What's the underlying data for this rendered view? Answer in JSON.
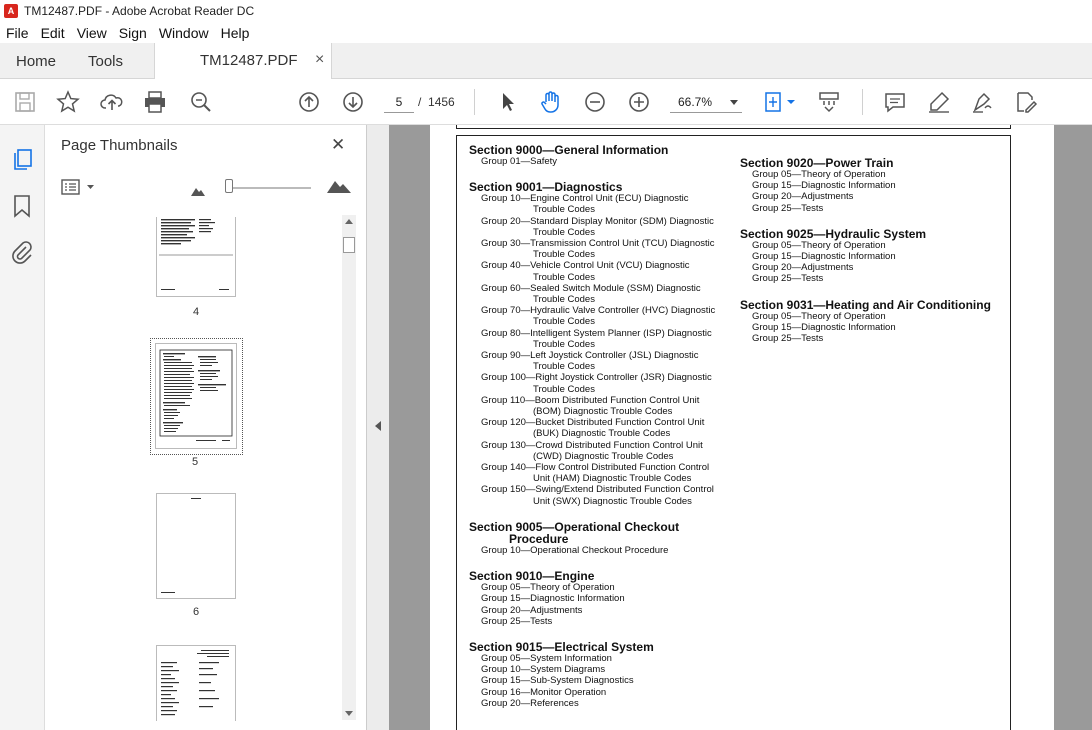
{
  "window": {
    "title": "TM12487.PDF - Adobe Acrobat Reader DC"
  },
  "menu": [
    "File",
    "Edit",
    "View",
    "Sign",
    "Window",
    "Help"
  ],
  "tabs": {
    "home": "Home",
    "tools": "Tools",
    "document": "TM12487.PDF",
    "close": "×"
  },
  "toolbar": {
    "page_current": "5",
    "page_sep": "/",
    "page_total": "1456",
    "zoom": "66.7%"
  },
  "panel": {
    "title": "Page Thumbnails",
    "close": "✕"
  },
  "thumbnails": [
    {
      "label": "4"
    },
    {
      "label": "5"
    },
    {
      "label": "6"
    },
    {
      "label": ""
    }
  ],
  "document": {
    "left_column": [
      {
        "section": "Section 9000—General Information",
        "groups": [
          [
            "Group 01—Safety"
          ]
        ]
      },
      {
        "section": "Section 9001—Diagnostics",
        "groups": [
          [
            "Group 10—Engine Control Unit (ECU) Diagnostic",
            "Trouble Codes"
          ],
          [
            "Group 20—Standard Display Monitor (SDM) Diagnostic",
            "Trouble Codes"
          ],
          [
            "Group 30—Transmission Control Unit (TCU) Diagnostic",
            "Trouble Codes"
          ],
          [
            "Group 40—Vehicle Control Unit (VCU) Diagnostic",
            "Trouble Codes"
          ],
          [
            "Group 60—Sealed Switch Module (SSM) Diagnostic",
            "Trouble Codes"
          ],
          [
            "Group 70—Hydraulic Valve Controller (HVC) Diagnostic",
            "Trouble Codes"
          ],
          [
            "Group 80—Intelligent System Planner (ISP) Diagnostic",
            "Trouble Codes"
          ],
          [
            "Group 90—Left Joystick Controller (JSL) Diagnostic",
            "Trouble Codes"
          ],
          [
            "Group 100—Right Joystick Controller (JSR) Diagnostic",
            "Trouble Codes"
          ],
          [
            "Group 110—Boom Distributed Function Control Unit",
            "(BOM) Diagnostic Trouble Codes"
          ],
          [
            "Group 120—Bucket Distributed Function Control Unit",
            "(BUK) Diagnostic Trouble Codes"
          ],
          [
            "Group 130—Crowd Distributed Function Control Unit",
            "(CWD) Diagnostic Trouble Codes"
          ],
          [
            "Group 140—Flow Control Distributed Function Control",
            "Unit (HAM) Diagnostic Trouble Codes"
          ],
          [
            "Group 150—Swing/Extend Distributed Function Control",
            "Unit (SWX) Diagnostic Trouble Codes"
          ]
        ]
      },
      {
        "section": "Section 9005—Operational Checkout\n            Procedure",
        "groups": [
          [
            "Group 10—Operational Checkout Procedure"
          ]
        ]
      },
      {
        "section": "Section 9010—Engine",
        "groups": [
          [
            "Group 05—Theory of Operation"
          ],
          [
            "Group 15—Diagnostic Information"
          ],
          [
            "Group 20—Adjustments"
          ],
          [
            "Group 25—Tests"
          ]
        ]
      },
      {
        "section": "Section 9015—Electrical System",
        "groups": [
          [
            "Group 05—System Information"
          ],
          [
            "Group 10—System Diagrams"
          ],
          [
            "Group 15—Sub-System Diagnostics"
          ],
          [
            "Group 16—Monitor Operation"
          ],
          [
            "Group 20—References"
          ]
        ]
      }
    ],
    "right_column": [
      {
        "section": "Section 9020—Power Train",
        "groups": [
          [
            "Group 05—Theory of Operation"
          ],
          [
            "Group 15—Diagnostic Information"
          ],
          [
            "Group 20—Adjustments"
          ],
          [
            "Group 25—Tests"
          ]
        ]
      },
      {
        "section": "Section 9025—Hydraulic System",
        "groups": [
          [
            "Group 05—Theory of Operation"
          ],
          [
            "Group 15—Diagnostic Information"
          ],
          [
            "Group 20—Adjustments"
          ],
          [
            "Group 25—Tests"
          ]
        ]
      },
      {
        "section": "Section 9031—Heating and Air Conditioning",
        "groups": [
          [
            "Group 05—Theory of Operation"
          ],
          [
            "Group 15—Diagnostic Information"
          ],
          [
            "Group 25—Tests"
          ]
        ]
      }
    ]
  }
}
